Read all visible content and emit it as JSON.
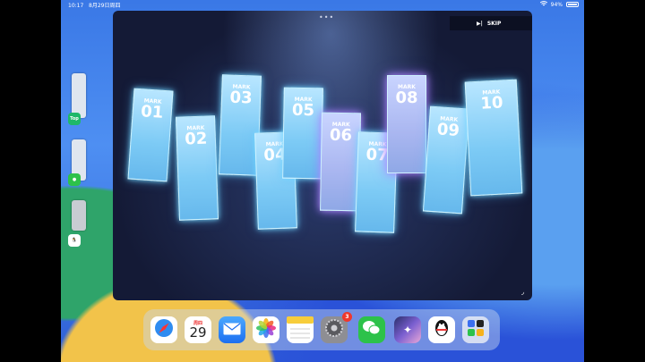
{
  "status_bar": {
    "time": "10:17",
    "date": "8月29日周四",
    "battery": "94%"
  },
  "slide_over": {
    "top_label": "Top"
  },
  "game": {
    "grabber": "•••",
    "skip_label": "SKIP",
    "mark_label": "MARK",
    "cards": [
      "01",
      "02",
      "03",
      "04",
      "05",
      "06",
      "07",
      "08",
      "09",
      "10"
    ]
  },
  "dock": {
    "calendar_weekday": "周四",
    "calendar_day": "29",
    "settings_badge": "3"
  },
  "colors": {
    "accent": "#3a78e6",
    "badge": "#f0382c",
    "card": "#7ccaf5"
  }
}
